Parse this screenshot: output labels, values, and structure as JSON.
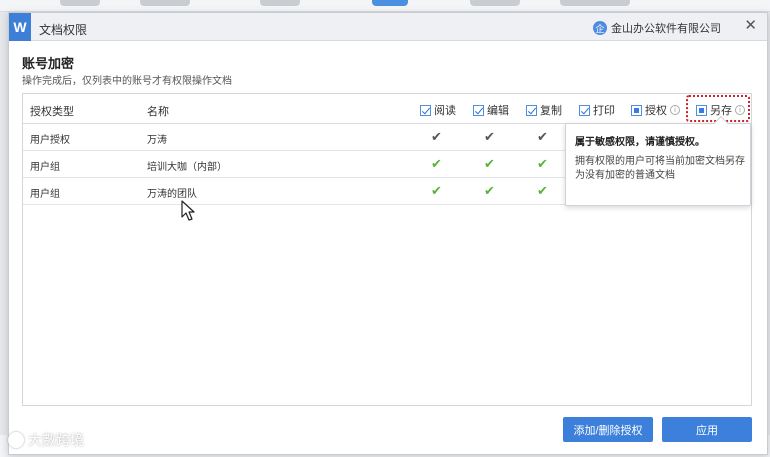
{
  "dialog": {
    "title": "文档权限",
    "logo_letter": "W",
    "company": "金山办公软件有限公司",
    "company_icon_glyph": "企",
    "close_glyph": "✕"
  },
  "section": {
    "title": "账号加密",
    "description": "操作完成后，仅列表中的账号才有权限操作文档"
  },
  "table": {
    "col_type": "授权类型",
    "col_name": "名称",
    "permissions": [
      {
        "label": "阅读",
        "state": "checked"
      },
      {
        "label": "编辑",
        "state": "checked"
      },
      {
        "label": "复制",
        "state": "checked"
      },
      {
        "label": "打印",
        "state": "checked"
      },
      {
        "label": "授权",
        "state": "partial"
      },
      {
        "label": "另存",
        "state": "partial"
      }
    ],
    "rows": [
      {
        "type": "用户授权",
        "name": "万涛",
        "check_color": "gray"
      },
      {
        "type": "用户组",
        "name": "培训大咖（内部）",
        "check_color": "green"
      },
      {
        "type": "用户组",
        "name": "万涛的团队",
        "check_color": "green"
      }
    ],
    "check_glyph": "✔"
  },
  "tooltip": {
    "title": "属于敏感权限，请谨慎授权。",
    "body": "拥有权限的用户可将当前加密文档另存为没有加密的普通文档"
  },
  "buttons": {
    "add_remove": "添加/删除授权",
    "apply": "应用"
  },
  "watermark": {
    "text": "大數跨境"
  },
  "colors": {
    "accent": "#3d80db",
    "check_green": "#58b33a",
    "check_gray": "#555555",
    "highlight": "#d0202a"
  }
}
